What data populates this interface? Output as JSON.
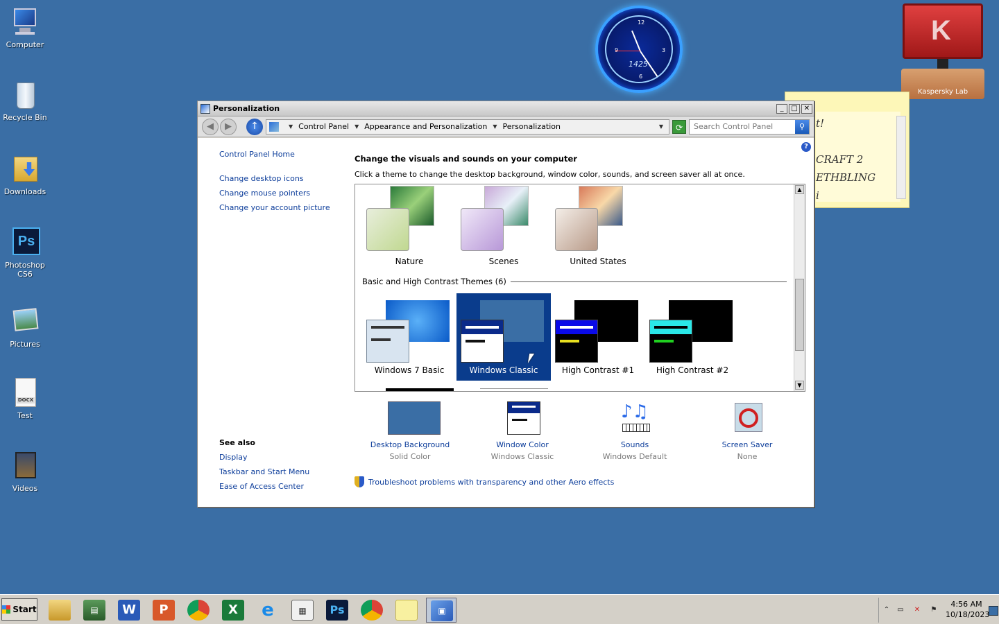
{
  "desktop": {
    "icons": [
      {
        "label": "Computer"
      },
      {
        "label": "Recycle Bin"
      },
      {
        "label": "Downloads"
      },
      {
        "label": "Photoshop CS6"
      },
      {
        "label": "Pictures"
      },
      {
        "label": "Test"
      },
      {
        "label": "Videos"
      }
    ],
    "clock": {
      "digital": "1425"
    },
    "kaspersky": {
      "label": "Kaspersky Lab"
    },
    "sticky_note": {
      "lines": [
        "t!",
        "CRAFT 2",
        "ETHBLING",
        "i"
      ]
    }
  },
  "window": {
    "title": "Personalization",
    "breadcrumbs": [
      "Control Panel",
      "Appearance and Personalization",
      "Personalization"
    ],
    "search_placeholder": "Search Control Panel",
    "left_links": [
      "Control Panel Home",
      "Change desktop icons",
      "Change mouse pointers",
      "Change your account picture"
    ],
    "see_also": {
      "title": "See also",
      "links": [
        "Display",
        "Taskbar and Start Menu",
        "Ease of Access Center"
      ]
    },
    "heading": "Change the visuals and sounds on your computer",
    "subheading": "Click a theme to change the desktop background, window color, sounds, and screen saver all at once.",
    "aero_themes": [
      {
        "name": "Nature"
      },
      {
        "name": "Scenes"
      },
      {
        "name": "United States"
      }
    ],
    "basic_group_label": "Basic and High Contrast Themes (6)",
    "basic_themes": [
      {
        "name": "Windows 7 Basic"
      },
      {
        "name": "Windows Classic",
        "selected": true
      },
      {
        "name": "High Contrast #1"
      },
      {
        "name": "High Contrast #2"
      }
    ],
    "settings": [
      {
        "title": "Desktop Background",
        "value": "Solid Color"
      },
      {
        "title": "Window Color",
        "value": "Windows Classic"
      },
      {
        "title": "Sounds",
        "value": "Windows Default"
      },
      {
        "title": "Screen Saver",
        "value": "None"
      }
    ],
    "troubleshoot": "Troubleshoot problems with transparency and other Aero effects"
  },
  "taskbar": {
    "start_label": "Start",
    "time": "4:56 AM",
    "date": "10/18/2023"
  },
  "colors": {
    "desktop": "#3a6ea5",
    "link": "#0b3c9a",
    "selected": "#0a3c8c"
  }
}
